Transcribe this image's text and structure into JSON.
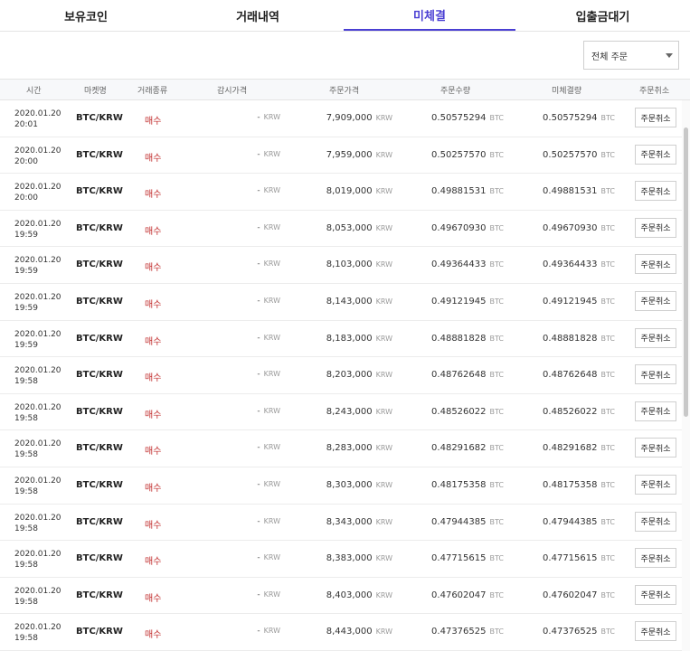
{
  "tabs": [
    {
      "label": "보유코인"
    },
    {
      "label": "거래내역"
    },
    {
      "label": "미체결",
      "active": true
    },
    {
      "label": "입출금대기"
    }
  ],
  "filter": {
    "selected": "전체 주문"
  },
  "columns": {
    "time": "시간",
    "market": "마켓명",
    "type": "거래종류",
    "watch_price": "감시가격",
    "order_price": "주문가격",
    "order_qty": "주문수량",
    "unfilled_qty": "미체결량",
    "cancel": "주문취소"
  },
  "colors": {
    "accent": "#4a3fd3",
    "buy": "#c12d2d"
  },
  "orders": [
    {
      "date": "2020.01.20",
      "time": "20:01",
      "market": "BTC/KRW",
      "side": "매수",
      "watch": "-",
      "watch_unit": "KRW",
      "price": "7,909,000",
      "price_unit": "KRW",
      "qty": "0.50575294",
      "qty_unit": "BTC",
      "unfilled": "0.50575294",
      "unfilled_unit": "BTC",
      "cancel_label": "주문취소"
    },
    {
      "date": "2020.01.20",
      "time": "20:00",
      "market": "BTC/KRW",
      "side": "매수",
      "watch": "-",
      "watch_unit": "KRW",
      "price": "7,959,000",
      "price_unit": "KRW",
      "qty": "0.50257570",
      "qty_unit": "BTC",
      "unfilled": "0.50257570",
      "unfilled_unit": "BTC",
      "cancel_label": "주문취소"
    },
    {
      "date": "2020.01.20",
      "time": "20:00",
      "market": "BTC/KRW",
      "side": "매수",
      "watch": "-",
      "watch_unit": "KRW",
      "price": "8,019,000",
      "price_unit": "KRW",
      "qty": "0.49881531",
      "qty_unit": "BTC",
      "unfilled": "0.49881531",
      "unfilled_unit": "BTC",
      "cancel_label": "주문취소"
    },
    {
      "date": "2020.01.20",
      "time": "19:59",
      "market": "BTC/KRW",
      "side": "매수",
      "watch": "-",
      "watch_unit": "KRW",
      "price": "8,053,000",
      "price_unit": "KRW",
      "qty": "0.49670930",
      "qty_unit": "BTC",
      "unfilled": "0.49670930",
      "unfilled_unit": "BTC",
      "cancel_label": "주문취소"
    },
    {
      "date": "2020.01.20",
      "time": "19:59",
      "market": "BTC/KRW",
      "side": "매수",
      "watch": "-",
      "watch_unit": "KRW",
      "price": "8,103,000",
      "price_unit": "KRW",
      "qty": "0.49364433",
      "qty_unit": "BTC",
      "unfilled": "0.49364433",
      "unfilled_unit": "BTC",
      "cancel_label": "주문취소"
    },
    {
      "date": "2020.01.20",
      "time": "19:59",
      "market": "BTC/KRW",
      "side": "매수",
      "watch": "-",
      "watch_unit": "KRW",
      "price": "8,143,000",
      "price_unit": "KRW",
      "qty": "0.49121945",
      "qty_unit": "BTC",
      "unfilled": "0.49121945",
      "unfilled_unit": "BTC",
      "cancel_label": "주문취소"
    },
    {
      "date": "2020.01.20",
      "time": "19:59",
      "market": "BTC/KRW",
      "side": "매수",
      "watch": "-",
      "watch_unit": "KRW",
      "price": "8,183,000",
      "price_unit": "KRW",
      "qty": "0.48881828",
      "qty_unit": "BTC",
      "unfilled": "0.48881828",
      "unfilled_unit": "BTC",
      "cancel_label": "주문취소"
    },
    {
      "date": "2020.01.20",
      "time": "19:58",
      "market": "BTC/KRW",
      "side": "매수",
      "watch": "-",
      "watch_unit": "KRW",
      "price": "8,203,000",
      "price_unit": "KRW",
      "qty": "0.48762648",
      "qty_unit": "BTC",
      "unfilled": "0.48762648",
      "unfilled_unit": "BTC",
      "cancel_label": "주문취소"
    },
    {
      "date": "2020.01.20",
      "time": "19:58",
      "market": "BTC/KRW",
      "side": "매수",
      "watch": "-",
      "watch_unit": "KRW",
      "price": "8,243,000",
      "price_unit": "KRW",
      "qty": "0.48526022",
      "qty_unit": "BTC",
      "unfilled": "0.48526022",
      "unfilled_unit": "BTC",
      "cancel_label": "주문취소"
    },
    {
      "date": "2020.01.20",
      "time": "19:58",
      "market": "BTC/KRW",
      "side": "매수",
      "watch": "-",
      "watch_unit": "KRW",
      "price": "8,283,000",
      "price_unit": "KRW",
      "qty": "0.48291682",
      "qty_unit": "BTC",
      "unfilled": "0.48291682",
      "unfilled_unit": "BTC",
      "cancel_label": "주문취소"
    },
    {
      "date": "2020.01.20",
      "time": "19:58",
      "market": "BTC/KRW",
      "side": "매수",
      "watch": "-",
      "watch_unit": "KRW",
      "price": "8,303,000",
      "price_unit": "KRW",
      "qty": "0.48175358",
      "qty_unit": "BTC",
      "unfilled": "0.48175358",
      "unfilled_unit": "BTC",
      "cancel_label": "주문취소"
    },
    {
      "date": "2020.01.20",
      "time": "19:58",
      "market": "BTC/KRW",
      "side": "매수",
      "watch": "-",
      "watch_unit": "KRW",
      "price": "8,343,000",
      "price_unit": "KRW",
      "qty": "0.47944385",
      "qty_unit": "BTC",
      "unfilled": "0.47944385",
      "unfilled_unit": "BTC",
      "cancel_label": "주문취소"
    },
    {
      "date": "2020.01.20",
      "time": "19:58",
      "market": "BTC/KRW",
      "side": "매수",
      "watch": "-",
      "watch_unit": "KRW",
      "price": "8,383,000",
      "price_unit": "KRW",
      "qty": "0.47715615",
      "qty_unit": "BTC",
      "unfilled": "0.47715615",
      "unfilled_unit": "BTC",
      "cancel_label": "주문취소"
    },
    {
      "date": "2020.01.20",
      "time": "19:58",
      "market": "BTC/KRW",
      "side": "매수",
      "watch": "-",
      "watch_unit": "KRW",
      "price": "8,403,000",
      "price_unit": "KRW",
      "qty": "0.47602047",
      "qty_unit": "BTC",
      "unfilled": "0.47602047",
      "unfilled_unit": "BTC",
      "cancel_label": "주문취소"
    },
    {
      "date": "2020.01.20",
      "time": "19:58",
      "market": "BTC/KRW",
      "side": "매수",
      "watch": "-",
      "watch_unit": "KRW",
      "price": "8,443,000",
      "price_unit": "KRW",
      "qty": "0.47376525",
      "qty_unit": "BTC",
      "unfilled": "0.47376525",
      "unfilled_unit": "BTC",
      "cancel_label": "주문취소"
    }
  ]
}
